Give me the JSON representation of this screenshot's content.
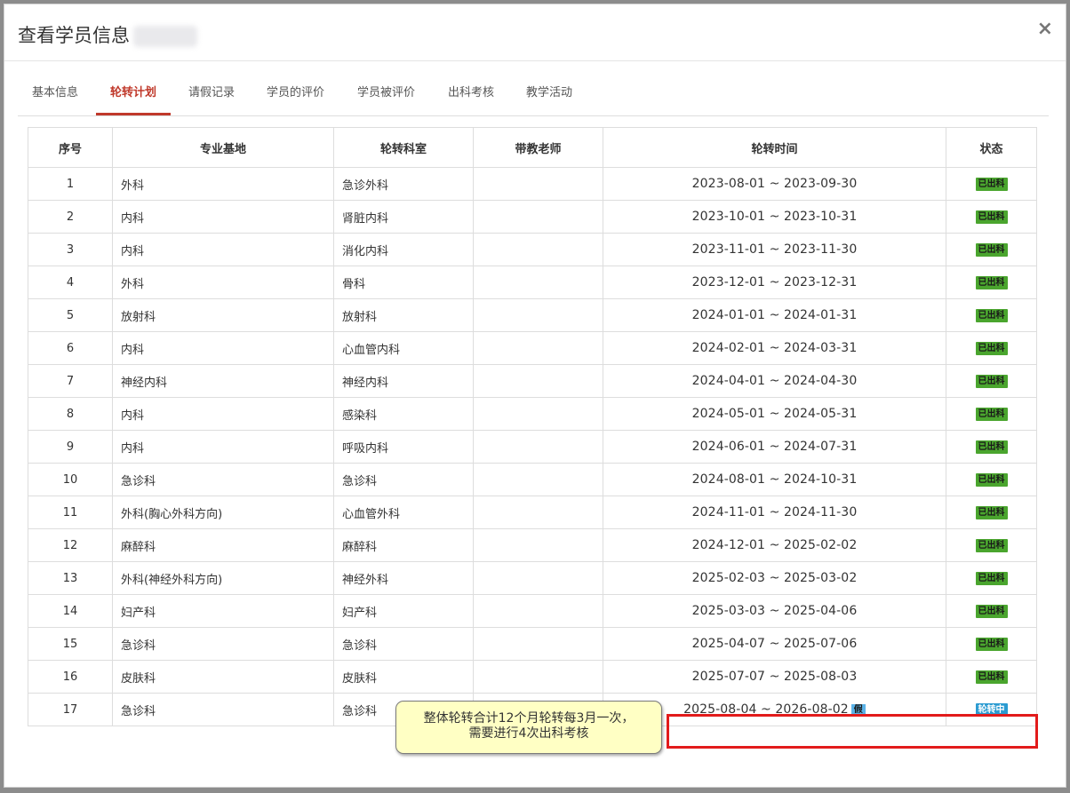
{
  "modal": {
    "title": "查看学员信息",
    "close_symbol": "×"
  },
  "tabs": [
    {
      "label": "基本信息",
      "active": false
    },
    {
      "label": "轮转计划",
      "active": true
    },
    {
      "label": "请假记录",
      "active": false
    },
    {
      "label": "学员的评价",
      "active": false
    },
    {
      "label": "学员被评价",
      "active": false
    },
    {
      "label": "出科考核",
      "active": false
    },
    {
      "label": "教学活动",
      "active": false
    }
  ],
  "table": {
    "headers": [
      "序号",
      "专业基地",
      "轮转科室",
      "带教老师",
      "轮转时间",
      "状态"
    ],
    "rows": [
      {
        "no": "1",
        "base": "外科",
        "dept": "急诊外科",
        "teacher": "",
        "time": "2023-08-01 ~ 2023-09-30",
        "status": "已出科"
      },
      {
        "no": "2",
        "base": "内科",
        "dept": "肾脏内科",
        "teacher": "",
        "time": "2023-10-01 ~ 2023-10-31",
        "status": "已出科"
      },
      {
        "no": "3",
        "base": "内科",
        "dept": "消化内科",
        "teacher": "",
        "time": "2023-11-01 ~ 2023-11-30",
        "status": "已出科"
      },
      {
        "no": "4",
        "base": "外科",
        "dept": "骨科",
        "teacher": "",
        "time": "2023-12-01 ~ 2023-12-31",
        "status": "已出科"
      },
      {
        "no": "5",
        "base": "放射科",
        "dept": "放射科",
        "teacher": "",
        "time": "2024-01-01 ~ 2024-01-31",
        "status": "已出科"
      },
      {
        "no": "6",
        "base": "内科",
        "dept": "心血管内科",
        "teacher": "",
        "time": "2024-02-01 ~ 2024-03-31",
        "status": "已出科"
      },
      {
        "no": "7",
        "base": "神经内科",
        "dept": "神经内科",
        "teacher": "",
        "time": "2024-04-01 ~ 2024-04-30",
        "status": "已出科"
      },
      {
        "no": "8",
        "base": "内科",
        "dept": "感染科",
        "teacher": "",
        "time": "2024-05-01 ~ 2024-05-31",
        "status": "已出科"
      },
      {
        "no": "9",
        "base": "内科",
        "dept": "呼吸内科",
        "teacher": "",
        "time": "2024-06-01 ~ 2024-07-31",
        "status": "已出科"
      },
      {
        "no": "10",
        "base": "急诊科",
        "dept": "急诊科",
        "teacher": "",
        "time": "2024-08-01 ~ 2024-10-31",
        "status": "已出科"
      },
      {
        "no": "11",
        "base": "外科(胸心外科方向)",
        "dept": "心血管外科",
        "teacher": "",
        "time": "2024-11-01 ~ 2024-11-30",
        "status": "已出科"
      },
      {
        "no": "12",
        "base": "麻醉科",
        "dept": "麻醉科",
        "teacher": "",
        "time": "2024-12-01 ~ 2025-02-02",
        "status": "已出科"
      },
      {
        "no": "13",
        "base": "外科(神经外科方向)",
        "dept": "神经外科",
        "teacher": "",
        "time": "2025-02-03 ~ 2025-03-02",
        "status": "已出科"
      },
      {
        "no": "14",
        "base": "妇产科",
        "dept": "妇产科",
        "teacher": "",
        "time": "2025-03-03 ~ 2025-04-06",
        "status": "已出科"
      },
      {
        "no": "15",
        "base": "急诊科",
        "dept": "急诊科",
        "teacher": "",
        "time": "2025-04-07 ~ 2025-07-06",
        "status": "已出科"
      },
      {
        "no": "16",
        "base": "皮肤科",
        "dept": "皮肤科",
        "teacher": "",
        "time": "2025-07-07 ~ 2025-08-03",
        "status": "已出科"
      },
      {
        "no": "17",
        "base": "急诊科",
        "dept": "急诊科",
        "teacher": "",
        "time": "2025-08-04 ~ 2026-08-02",
        "status": "轮转中",
        "leave_badge": "假"
      }
    ]
  },
  "callout": {
    "line1": "整体轮转合计12个月轮转每3月一次，",
    "line2": "需要进行4次出科考核"
  },
  "colors": {
    "active_tab": "#c0392b",
    "badge_done": "#4aa52e",
    "badge_active": "#2b9bd1",
    "highlight": "#e21b1b",
    "callout_bg": "#ffffc4"
  }
}
